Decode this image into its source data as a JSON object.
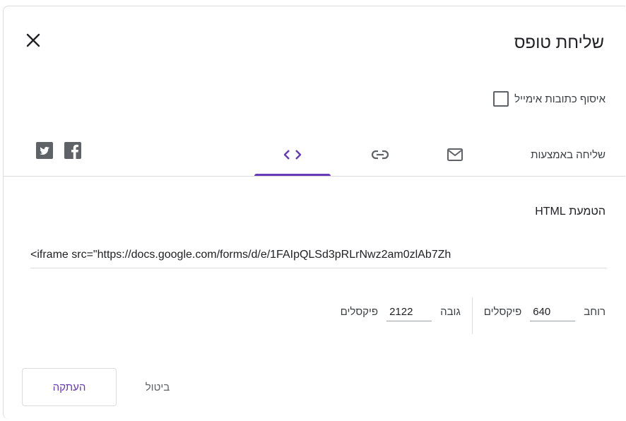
{
  "dialog": {
    "title": "שליחת טופס",
    "collect_emails_label": "איסוף כתובות אימייל",
    "collect_emails_checked": false
  },
  "send_via": {
    "label": "שליחה באמצעות",
    "tabs": [
      {
        "id": "email",
        "icon": "mail-icon",
        "selected": false
      },
      {
        "id": "link",
        "icon": "link-icon",
        "selected": false
      },
      {
        "id": "embed",
        "icon": "embed-code-icon",
        "selected": true
      }
    ],
    "social": [
      {
        "id": "facebook",
        "icon": "facebook-icon"
      },
      {
        "id": "twitter",
        "icon": "twitter-icon"
      }
    ]
  },
  "embed": {
    "heading": "הטמעת HTML",
    "code": "<iframe src=\"https://docs.google.com/forms/d/e/1FAIpQLSd3pRLrNwz2am0zlAb7Zh",
    "width_label": "רוחב",
    "width_value": "640",
    "width_unit": "פיקסלים",
    "height_label": "גובה",
    "height_value": "2122",
    "height_unit": "פיקסלים"
  },
  "actions": {
    "cancel_label": "ביטול",
    "copy_label": "העתקה"
  },
  "colors": {
    "accent": "#673ab7",
    "icon": "#5f6368",
    "divider": "#dadce0"
  }
}
